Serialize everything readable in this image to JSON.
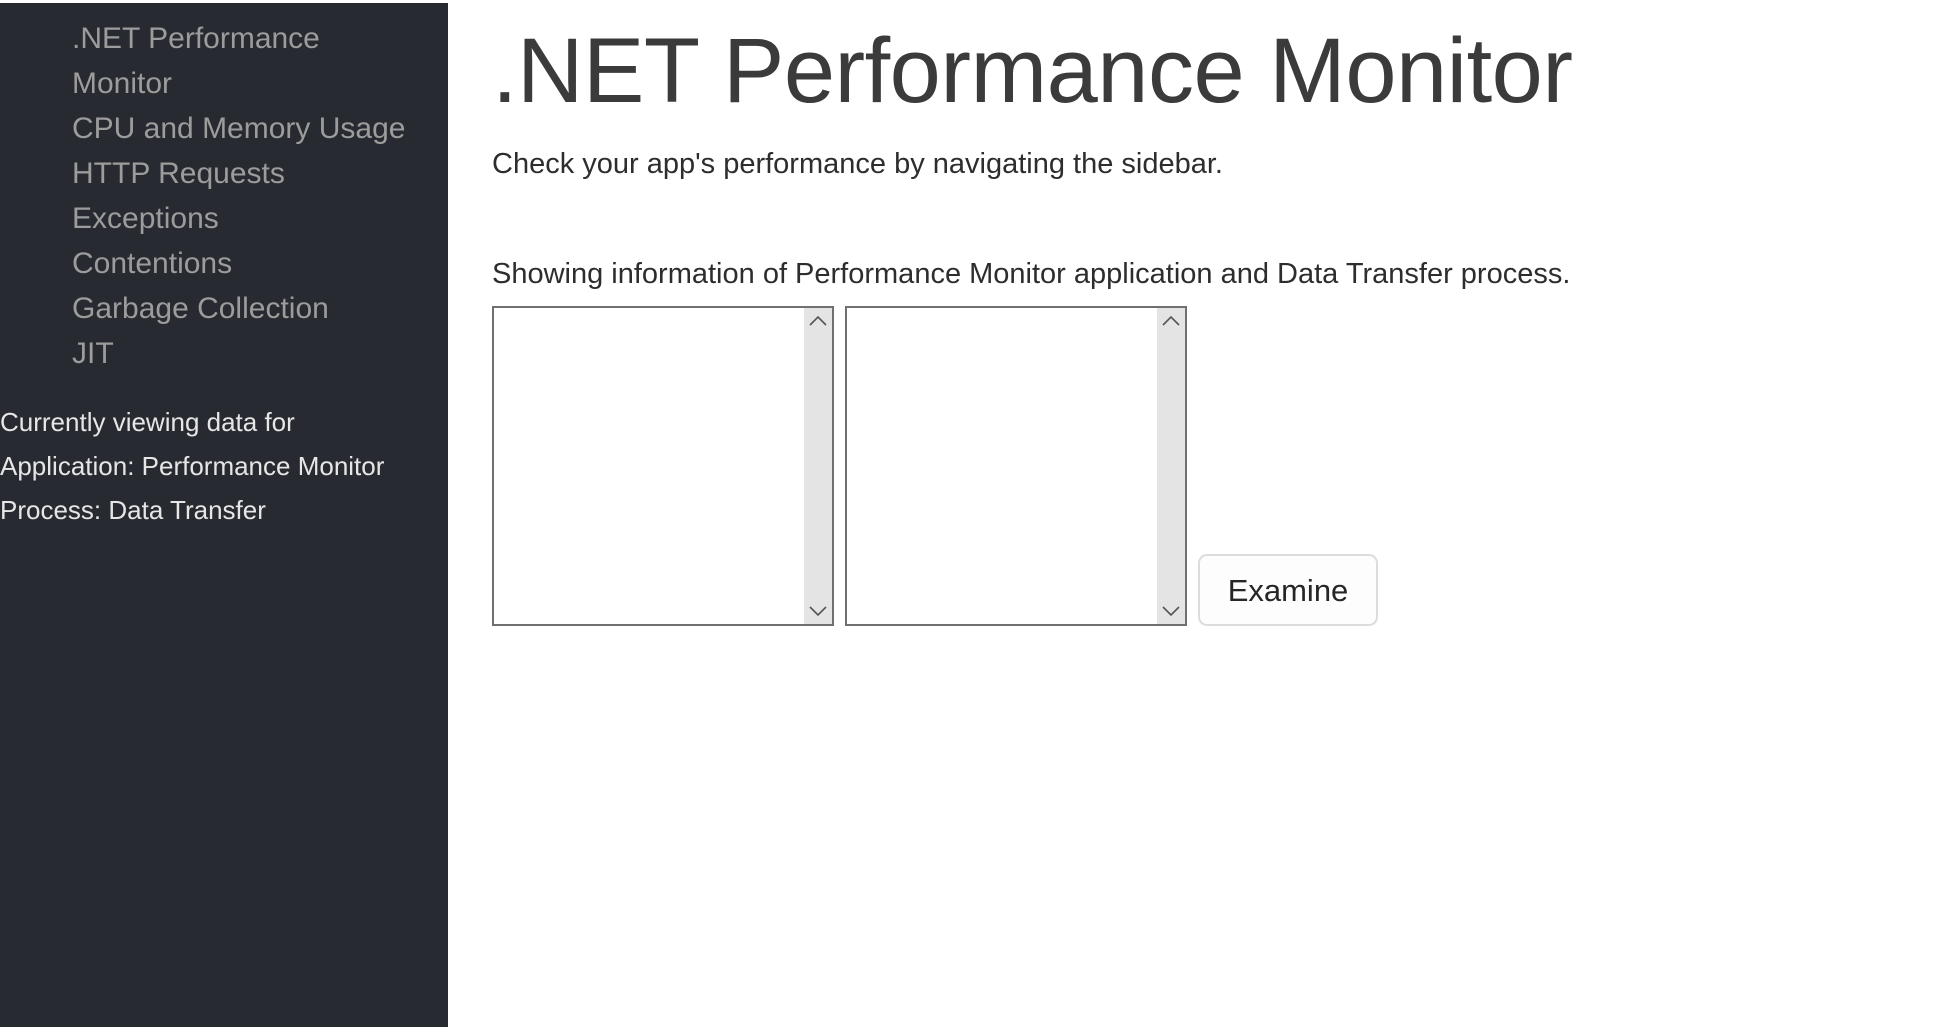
{
  "sidebar": {
    "nav_items": [
      {
        "label": ".NET Performance Monitor",
        "name": "sidebar-item-net-performance-monitor"
      },
      {
        "label": "CPU and Memory Usage",
        "name": "sidebar-item-cpu-and-memory-usage"
      },
      {
        "label": "HTTP Requests",
        "name": "sidebar-item-http-requests"
      },
      {
        "label": "Exceptions",
        "name": "sidebar-item-exceptions"
      },
      {
        "label": "Contentions",
        "name": "sidebar-item-contentions"
      },
      {
        "label": "Garbage Collection",
        "name": "sidebar-item-garbage-collection"
      },
      {
        "label": "JIT",
        "name": "sidebar-item-jit"
      }
    ],
    "status": {
      "heading": "Currently viewing data for",
      "application": "Application: Performance Monitor",
      "process": "Process: Data Transfer"
    }
  },
  "main": {
    "title": ".NET Performance Monitor",
    "lede": "Check your app's performance by navigating the sidebar.",
    "info": "Showing information of Performance Monitor application and Data Transfer process.",
    "application_listbox": {
      "name": "application-listbox",
      "options": [],
      "scroll_up_icon": "chevron-up-icon",
      "scroll_down_icon": "chevron-down-icon"
    },
    "process_listbox": {
      "name": "process-listbox",
      "options": [],
      "scroll_up_icon": "chevron-up-icon",
      "scroll_down_icon": "chevron-down-icon"
    },
    "examine_button": "Examine"
  },
  "colors": {
    "sidebar_bg": "#272a30",
    "sidebar_link": "#9c9c9c",
    "sidebar_status": "#e6e6e6",
    "page_bg": "#ffffff",
    "title": "#3b3b3b",
    "body_text": "#2d2d2d",
    "listbox_border": "#707070",
    "scrollbar_track": "#e4e4e4",
    "button_border": "#dcdcdc"
  }
}
